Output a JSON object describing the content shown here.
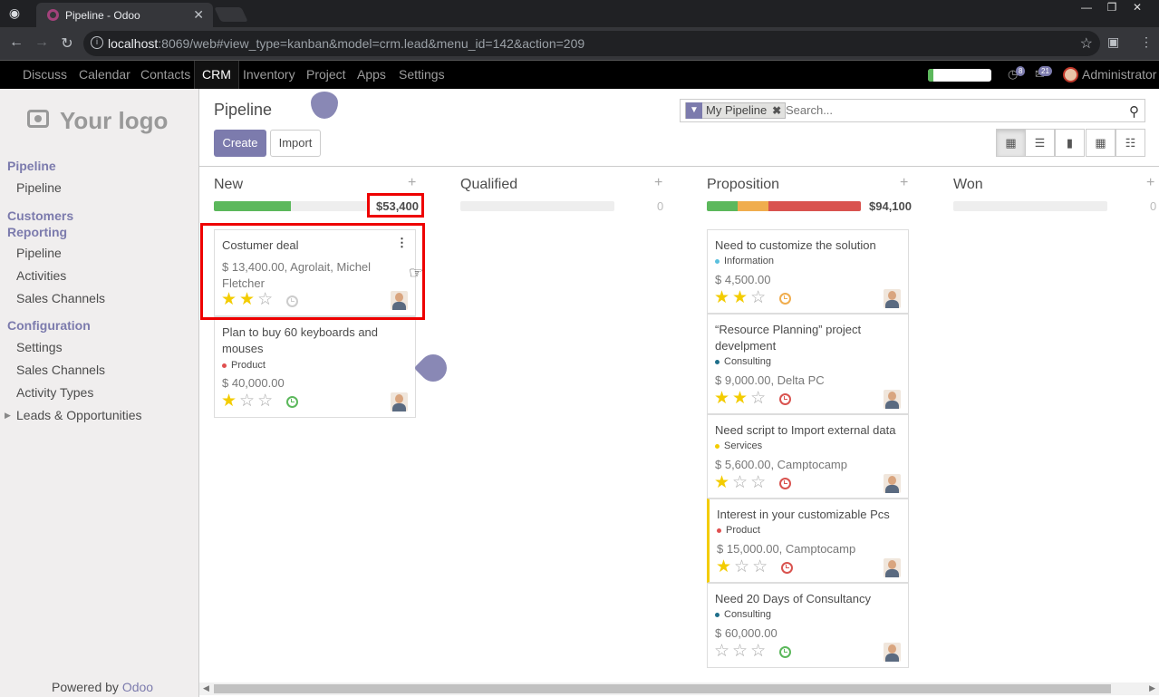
{
  "browser": {
    "tab_title": "Pipeline - Odoo",
    "url_host": "localhost",
    "url_rest": ":8069/web#view_type=kanban&model=crm.lead&menu_id=142&action=209"
  },
  "topmenu": {
    "items": [
      "Discuss",
      "Calendar",
      "Contacts",
      "CRM",
      "Inventory",
      "Project",
      "Apps",
      "Settings"
    ],
    "active": "CRM",
    "progress_fraction": 0.08,
    "badge_chat": "8",
    "badge_activity": "21",
    "user": "Administrator"
  },
  "sidebar": {
    "logo": "Your logo",
    "sections": [
      {
        "title": "Pipeline",
        "items": [
          "Pipeline"
        ]
      },
      {
        "title": "Customers Reporting",
        "items": [
          "Pipeline",
          "Activities",
          "Sales Channels"
        ]
      },
      {
        "title": "Configuration",
        "items": [
          "Settings",
          "Sales Channels",
          "Activity Types",
          "Leads & Opportunities"
        ]
      }
    ],
    "powered_prefix": "Powered by ",
    "powered_brand": "Odoo"
  },
  "control": {
    "breadcrumb": "Pipeline",
    "create": "Create",
    "import": "Import",
    "facet": "My Pipeline",
    "search_placeholder": "Search..."
  },
  "columns": [
    {
      "name": "New",
      "total": "$53,400",
      "bar": [
        {
          "color": "#5cb85c",
          "frac": 0.5
        },
        {
          "color": "#eeeeee",
          "frac": 0.5
        }
      ]
    },
    {
      "name": "Qualified",
      "total": "0",
      "bar": []
    },
    {
      "name": "Proposition",
      "total": "$94,100",
      "bar": [
        {
          "color": "#5cb85c",
          "frac": 0.2
        },
        {
          "color": "#f0ad4e",
          "frac": 0.2
        },
        {
          "color": "#d9534f",
          "frac": 0.6
        }
      ]
    },
    {
      "name": "Won",
      "total": "0",
      "bar": []
    }
  ],
  "cards": {
    "new": [
      {
        "title": "Costumer deal",
        "amount": "$ 13,400.00, Agrolait, Michel Fletcher",
        "stars": 2,
        "activity": "none"
      },
      {
        "title": "Plan to buy 60 keyboards and mouses",
        "tag": "Product",
        "tag_color": "#e05050",
        "amount": "$ 40,000.00",
        "stars": 1,
        "activity": "planned"
      }
    ],
    "proposition": [
      {
        "title": "Need to customize the solution",
        "tag": "Information",
        "tag_color": "#5bc0de",
        "amount": "$ 4,500.00",
        "stars": 2,
        "activity": "today"
      },
      {
        "title": "“Resource Planning” project develpment",
        "tag": "Consulting",
        "tag_color": "#1f6f8b",
        "amount": "$ 9,000.00, Delta PC",
        "stars": 2,
        "activity": "overdue"
      },
      {
        "title": "Need script to Import external data",
        "tag": "Services",
        "tag_color": "#f3cc00",
        "amount": "$ 5,600.00, Camptocamp",
        "stars": 1,
        "activity": "overdue"
      },
      {
        "title": "Interest in your customizable Pcs",
        "tag": "Product",
        "tag_color": "#e05050",
        "amount": "$ 15,000.00, Camptocamp",
        "stars": 1,
        "activity": "overdue"
      },
      {
        "title": "Need 20 Days of Consultancy",
        "tag": "Consulting",
        "tag_color": "#1f6f8b",
        "amount": "$ 60,000.00",
        "stars": 0,
        "activity": "planned"
      }
    ]
  },
  "colors": {
    "primary": "#7c7bad",
    "planned": "#5cb85c",
    "today": "#f0ad4e",
    "overdue": "#d9534f",
    "none": "#cccccc"
  }
}
